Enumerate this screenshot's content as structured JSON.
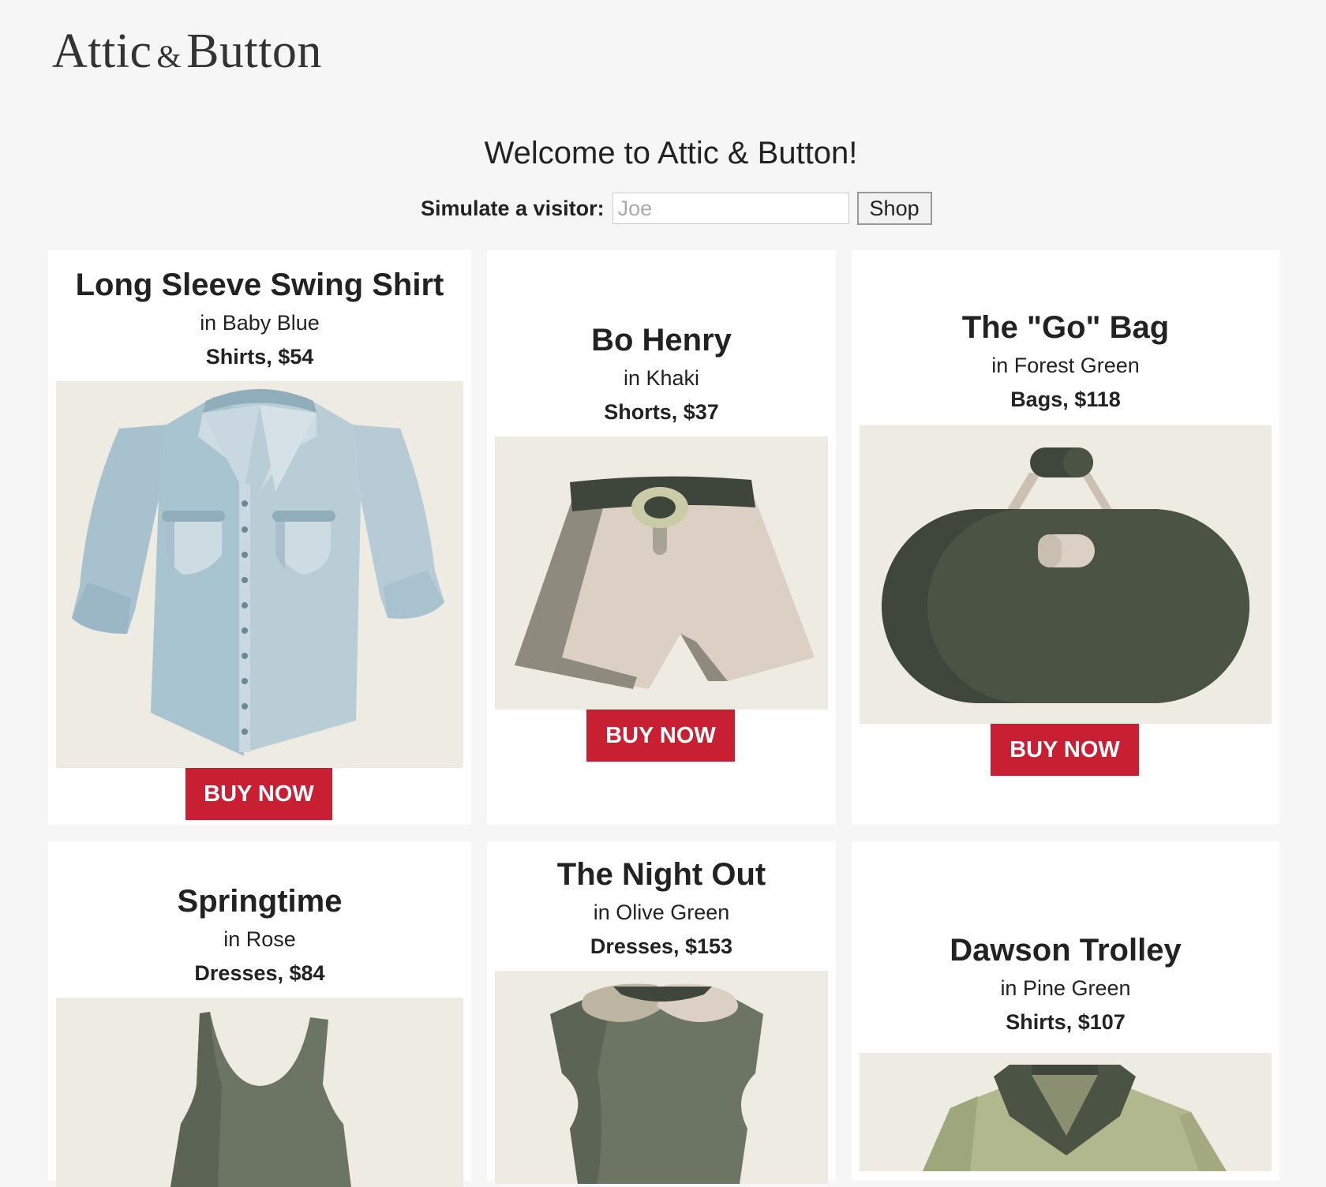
{
  "brand": {
    "name_part1": "Attic",
    "amp": "&",
    "name_part2": "Button"
  },
  "welcome": {
    "title": "Welcome to Attic & Button!",
    "visitor_label": "Simulate a visitor:",
    "visitor_placeholder": "Joe",
    "visitor_value": "",
    "shop_label": "Shop"
  },
  "products": [
    {
      "name": "Long Sleeve Swing Shirt",
      "color": "in Baby Blue",
      "price": "Shirts, $54",
      "image": "shirt-icon",
      "buy": "BUY NOW"
    },
    {
      "name": "Bo Henry",
      "color": "in Khaki",
      "price": "Shorts, $37",
      "image": "shorts-icon",
      "buy": "BUY NOW"
    },
    {
      "name": "The \"Go\" Bag",
      "color": "in Forest Green",
      "price": "Bags, $118",
      "image": "bag-icon",
      "buy": "BUY NOW"
    },
    {
      "name": "Springtime",
      "color": "in Rose",
      "price": "Dresses, $84",
      "image": "dress-icon"
    },
    {
      "name": "The Night Out",
      "color": "in Olive Green",
      "price": "Dresses, $153",
      "image": "collar-dress-icon"
    },
    {
      "name": "Dawson Trolley",
      "color": "in Pine Green",
      "price": "Shirts, $107",
      "image": "jacket-icon"
    }
  ],
  "colors": {
    "background": "#f6f6f6",
    "card": "#ffffff",
    "art_background": "#edebe2",
    "buy_button": "#c91f33"
  }
}
